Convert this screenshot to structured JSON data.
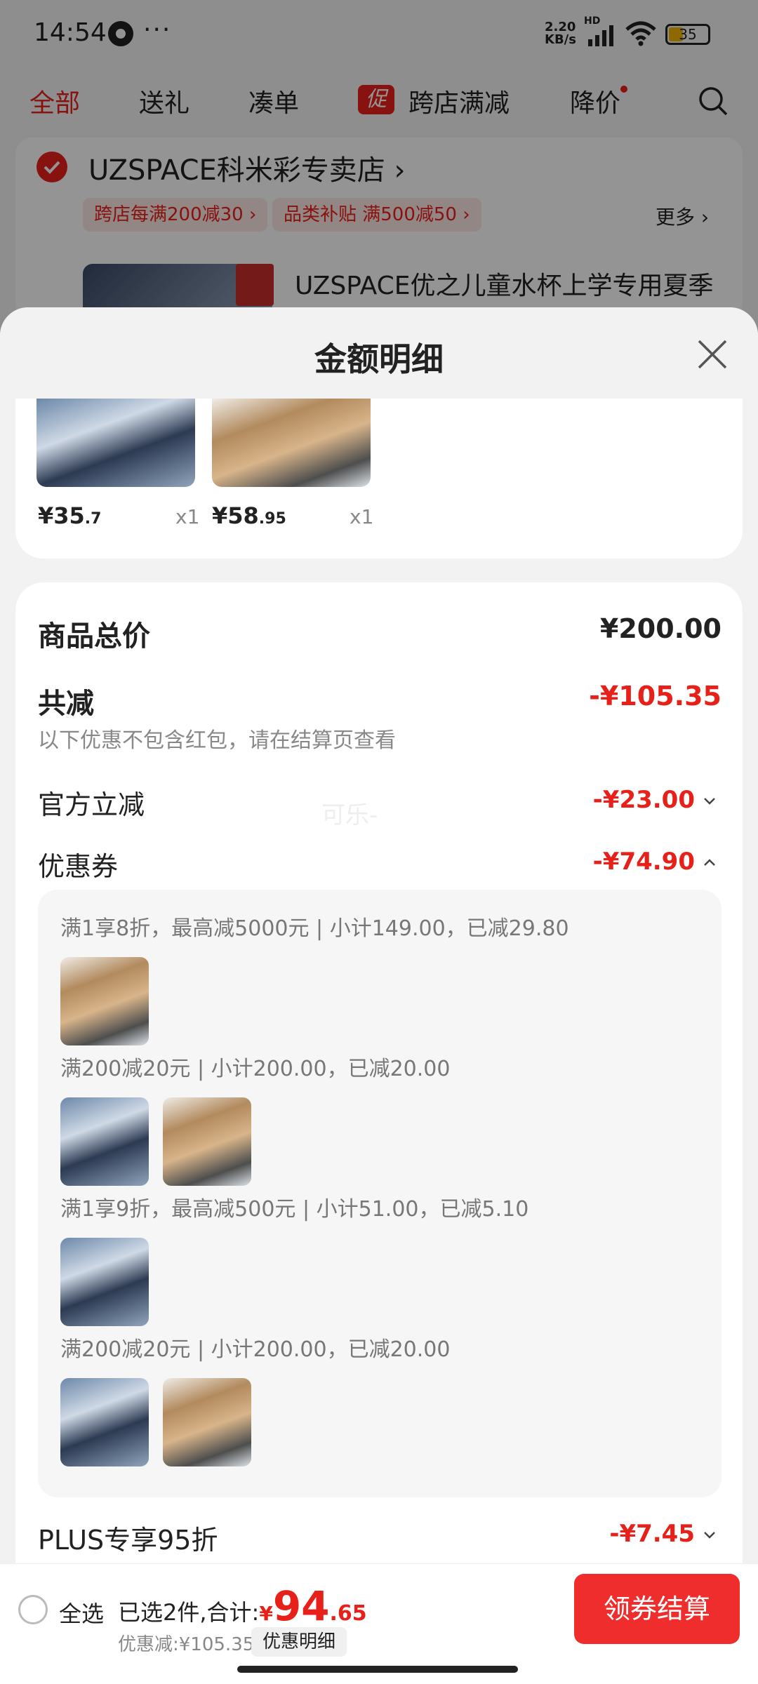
{
  "status_bar": {
    "time": "14:54",
    "net_speed": "2.20\nKB/s",
    "hd": "HD",
    "battery": "35"
  },
  "top_tabs": [
    {
      "label": "全部",
      "active": true
    },
    {
      "label": "送礼",
      "active": false
    },
    {
      "label": "凑单",
      "active": false
    },
    {
      "label": "跨店满减",
      "active": false,
      "badge": "促"
    },
    {
      "label": "降价",
      "active": false
    }
  ],
  "store": {
    "name": "UZSPACE科米彩专卖店 ›",
    "promos": [
      "跨店每满200减30 ›",
      "品类补贴 满500减50 ›"
    ],
    "more": "更多 ›",
    "product_title": "UZSPACE优之儿童水杯上学专用夏季"
  },
  "sheet": {
    "title": "金额明细",
    "products": [
      {
        "price_int": "¥35",
        "price_dec": ".7",
        "qty": "x1"
      },
      {
        "price_int": "¥58",
        "price_dec": ".95",
        "qty": "x1"
      }
    ],
    "total_label": "商品总价",
    "total_amount": "¥200.00",
    "reduce_label": "共减",
    "reduce_amount": "-¥105.35",
    "reduce_note": "以下优惠不包含红包，请在结算页查看",
    "official_label": "官方立减",
    "official_amount": "-¥23.00",
    "watermark": "可乐-",
    "coupon_label": "优惠券",
    "coupon_amount": "-¥74.90",
    "coupon_lines": [
      "满1享8折，最高减5000元 | 小计149.00，已减29.80",
      "满200减20元 | 小计200.00，已减20.00",
      "满1享9折，最高减500元 | 小计51.00，已减5.10",
      "满200减20元 | 小计200.00，已减20.00"
    ],
    "plus_label": "PLUS专享95折",
    "plus_amount": "-¥7.45"
  },
  "bottom": {
    "select_all": "全选",
    "summary_prefix": "已选2件,合计:",
    "total_yen": "¥",
    "total_int": "94",
    "total_dec": ".65",
    "discount_text": "优惠减:¥105.35",
    "detail_chip": "优惠明细",
    "checkout": "领券结算"
  },
  "colors": {
    "accent": "#e8201a",
    "checkout": "#ef2d2d"
  }
}
